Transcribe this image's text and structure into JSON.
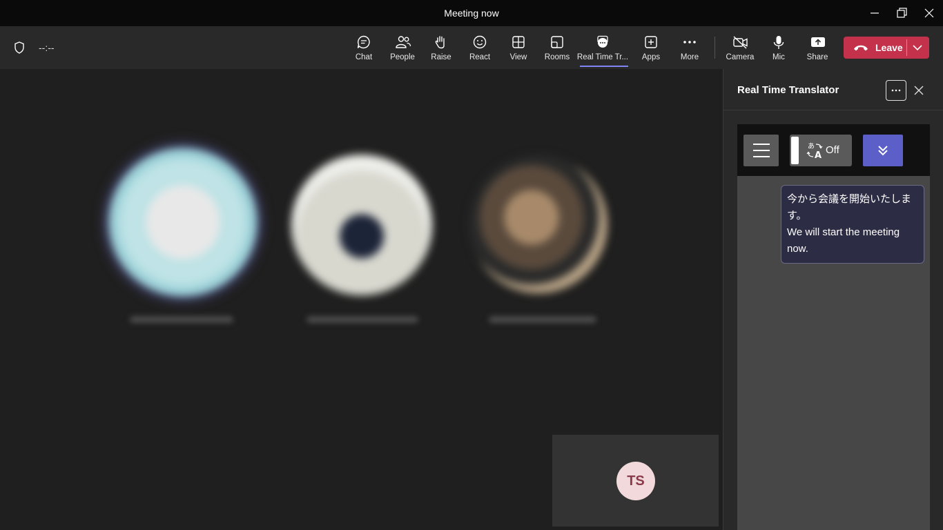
{
  "window": {
    "title": "Meeting now"
  },
  "toolbar": {
    "timer": "--:--",
    "buttons": [
      {
        "label": "Chat",
        "icon": "chat-icon"
      },
      {
        "label": "People",
        "icon": "people-icon"
      },
      {
        "label": "Raise",
        "icon": "hand-icon"
      },
      {
        "label": "React",
        "icon": "smiley-icon"
      },
      {
        "label": "View",
        "icon": "grid-icon"
      },
      {
        "label": "Rooms",
        "icon": "rooms-icon"
      },
      {
        "label": "Real Time Tr...",
        "icon": "app-chat-icon"
      },
      {
        "label": "Apps",
        "icon": "plus-box-icon"
      },
      {
        "label": "More",
        "icon": "ellipsis-icon"
      }
    ],
    "camera_label": "Camera",
    "mic_label": "Mic",
    "share_label": "Share",
    "leave_label": "Leave"
  },
  "self_tile": {
    "initials": "TS"
  },
  "panel": {
    "title": "Real Time Translator",
    "toggle_label": "Off",
    "message": {
      "original": "今から会議を開始いたします。",
      "translated": "We will start the meeting now."
    }
  },
  "colors": {
    "leave": "#c4314b",
    "accent": "#5b5fc7",
    "self_avatar_bg": "#f1d9dc"
  }
}
